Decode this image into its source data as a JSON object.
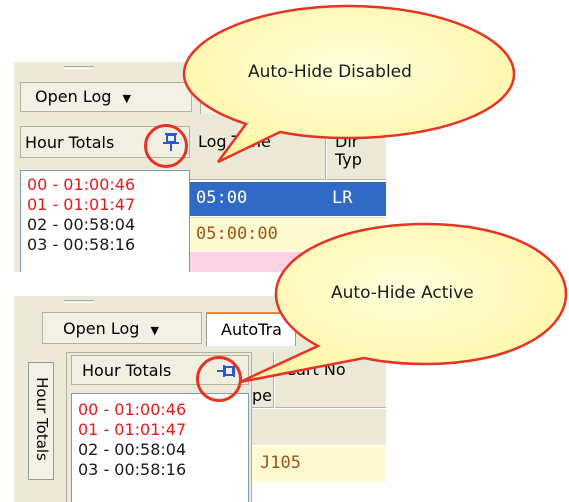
{
  "top_panel": {
    "toolbar_button_label": "Open Log",
    "header_label": "Hour Totals",
    "grid_headers": [
      "Log Time",
      "Dir",
      "Typ"
    ],
    "hour_totals": [
      {
        "text": "00 - 01:00:46",
        "color": "#e8191c"
      },
      {
        "text": "01 - 01:01:47",
        "color": "#e8191c"
      },
      {
        "text": "02 - 00:58:04",
        "color": "#1a1a1a"
      },
      {
        "text": "03 - 00:58:16",
        "color": "#1a1a1a"
      }
    ],
    "rows": [
      {
        "time": "05:00",
        "dir": "LR",
        "style": "selected"
      },
      {
        "time": "05:00:00",
        "dir": "",
        "style": "yellow"
      }
    ],
    "callout": "Auto-Hide Disabled"
  },
  "bottom_panel": {
    "toolbar_button_label": "Open Log",
    "tab_label": "AutoTra",
    "vertical_tab_label": "Hour Totals",
    "header_label": "Hour Totals",
    "grid_headers": [
      "Cart No",
      "pe"
    ],
    "hour_totals": [
      {
        "text": "00 - 01:00:46",
        "color": "#e8191c"
      },
      {
        "text": "01 - 01:01:47",
        "color": "#e8191c"
      },
      {
        "text": "02 - 00:58:04",
        "color": "#1a1a1a"
      },
      {
        "text": "03 - 00:58:16",
        "color": "#1a1a1a"
      }
    ],
    "cart_value": "J105",
    "callout": "Auto-Hide Active"
  },
  "colors": {
    "highlight_circle": "#e53325",
    "callout_fill": "#ffffc8",
    "selected_row": "#316ac5",
    "yellow_row": "#fffbd0"
  }
}
